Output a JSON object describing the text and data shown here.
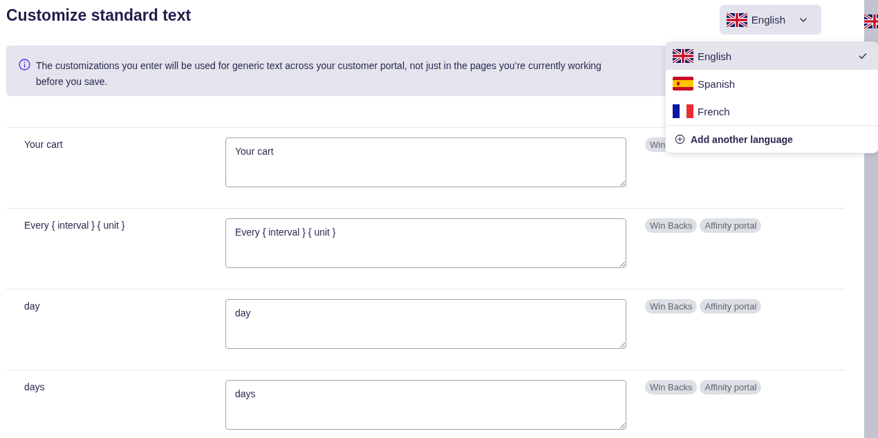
{
  "title": "Customize standard text",
  "language_button": {
    "label": "English"
  },
  "info_banner": {
    "lines": [
      "The customizations you enter will be used for generic text across your customer portal, not just in the pages you’re currently working",
      "before you save."
    ]
  },
  "rows": [
    {
      "label": "Your cart",
      "value": "Your cart",
      "tags": [
        "Win"
      ]
    },
    {
      "label": "Every { interval } { unit }",
      "value": "Every { interval } { unit }",
      "tags": [
        "Win Backs",
        "Affinity portal"
      ]
    },
    {
      "label": "day",
      "value": "day",
      "tags": [
        "Win Backs",
        "Affinity portal"
      ]
    },
    {
      "label": "days",
      "value": "days",
      "tags": [
        "Win Backs",
        "Affinity portal"
      ]
    }
  ],
  "language_menu": {
    "items": [
      {
        "label": "English",
        "kind": "uk",
        "selected": true
      },
      {
        "label": "Spanish",
        "kind": "es",
        "selected": false
      },
      {
        "label": "French",
        "kind": "fr",
        "selected": false
      }
    ],
    "add_label": "Add another language"
  }
}
